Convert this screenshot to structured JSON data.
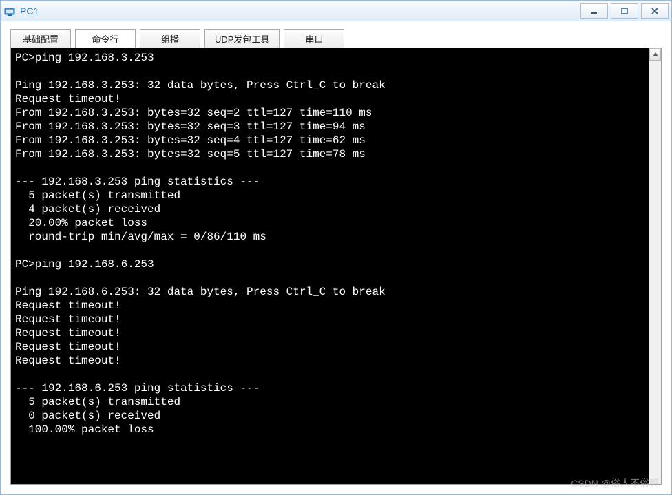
{
  "window": {
    "title": "PC1"
  },
  "tabs": [
    {
      "label": "基础配置",
      "active": false
    },
    {
      "label": "命令行",
      "active": true
    },
    {
      "label": "组播",
      "active": false
    },
    {
      "label": "UDP发包工具",
      "active": false
    },
    {
      "label": "串口",
      "active": false
    }
  ],
  "terminal": {
    "lines": [
      "PC>ping 192.168.3.253",
      "",
      "Ping 192.168.3.253: 32 data bytes, Press Ctrl_C to break",
      "Request timeout!",
      "From 192.168.3.253: bytes=32 seq=2 ttl=127 time=110 ms",
      "From 192.168.3.253: bytes=32 seq=3 ttl=127 time=94 ms",
      "From 192.168.3.253: bytes=32 seq=4 ttl=127 time=62 ms",
      "From 192.168.3.253: bytes=32 seq=5 ttl=127 time=78 ms",
      "",
      "--- 192.168.3.253 ping statistics ---",
      "  5 packet(s) transmitted",
      "  4 packet(s) received",
      "  20.00% packet loss",
      "  round-trip min/avg/max = 0/86/110 ms",
      "",
      "PC>ping 192.168.6.253",
      "",
      "Ping 192.168.6.253: 32 data bytes, Press Ctrl_C to break",
      "Request timeout!",
      "Request timeout!",
      "Request timeout!",
      "Request timeout!",
      "Request timeout!",
      "",
      "--- 192.168.6.253 ping statistics ---",
      "  5 packet(s) transmitted",
      "  0 packet(s) received",
      "  100.00% packet loss",
      ""
    ]
  },
  "watermark": "CSDN @俗人不俗鸭"
}
